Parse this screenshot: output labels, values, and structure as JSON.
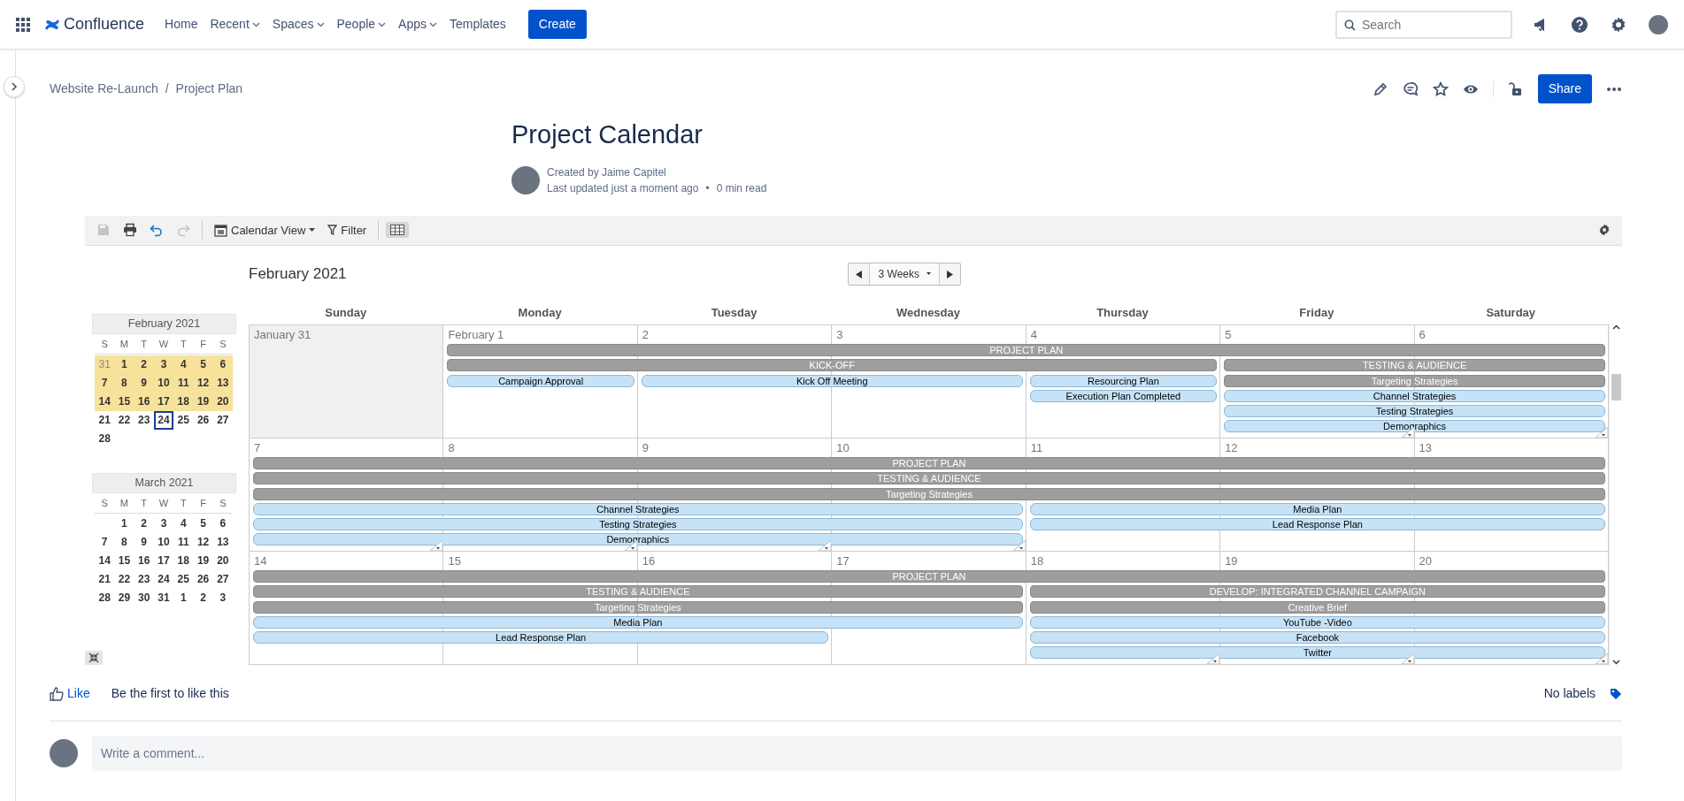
{
  "nav": {
    "brand": "Confluence",
    "items": [
      {
        "label": "Home",
        "dropdown": false
      },
      {
        "label": "Recent",
        "dropdown": true
      },
      {
        "label": "Spaces",
        "dropdown": true
      },
      {
        "label": "People",
        "dropdown": true
      },
      {
        "label": "Apps",
        "dropdown": true
      },
      {
        "label": "Templates",
        "dropdown": false
      }
    ],
    "create": "Create",
    "search": {
      "placeholder": "Search"
    }
  },
  "breadcrumbs": {
    "items": [
      "Website Re-Launch",
      "Project Plan"
    ],
    "separator": "/"
  },
  "share": "Share",
  "page": {
    "title": "Project Calendar",
    "author": "Created by Jaime Capitel",
    "updated": "Last updated just a moment ago",
    "separator": "•",
    "read_time": "0 min read"
  },
  "toolbar": {
    "items": [
      {
        "kind": "save",
        "disabled": true
      },
      {
        "kind": "print",
        "disabled": false
      },
      {
        "kind": "undo",
        "disabled": false
      },
      {
        "kind": "redo",
        "disabled": true
      }
    ],
    "view": "Calendar View",
    "filter": "Filter",
    "grid_toggle_selected": true
  },
  "mini_calendars": [
    {
      "title": "February 2021",
      "weekdays": [
        "S",
        "M",
        "T",
        "W",
        "T",
        "F",
        "S"
      ],
      "weeks": [
        [
          {
            "d": "31",
            "muted": true,
            "highlighted": true,
            "today": false
          },
          {
            "d": "1",
            "muted": false,
            "highlighted": true,
            "today": false
          },
          {
            "d": "2",
            "muted": false,
            "highlighted": true,
            "today": false
          },
          {
            "d": "3",
            "muted": false,
            "highlighted": true,
            "today": false
          },
          {
            "d": "4",
            "muted": false,
            "highlighted": true,
            "today": false
          },
          {
            "d": "5",
            "muted": false,
            "highlighted": true,
            "today": false
          },
          {
            "d": "6",
            "muted": false,
            "highlighted": true,
            "today": false
          }
        ],
        [
          {
            "d": "7",
            "muted": false,
            "highlighted": true,
            "today": false
          },
          {
            "d": "8",
            "muted": false,
            "highlighted": true,
            "today": false
          },
          {
            "d": "9",
            "muted": false,
            "highlighted": true,
            "today": false
          },
          {
            "d": "10",
            "muted": false,
            "highlighted": true,
            "today": false
          },
          {
            "d": "11",
            "muted": false,
            "highlighted": true,
            "today": false
          },
          {
            "d": "12",
            "muted": false,
            "highlighted": true,
            "today": false
          },
          {
            "d": "13",
            "muted": false,
            "highlighted": true,
            "today": false
          }
        ],
        [
          {
            "d": "14",
            "muted": false,
            "highlighted": true,
            "today": false
          },
          {
            "d": "15",
            "muted": false,
            "highlighted": true,
            "today": false
          },
          {
            "d": "16",
            "muted": false,
            "highlighted": true,
            "today": false
          },
          {
            "d": "17",
            "muted": false,
            "highlighted": true,
            "today": false
          },
          {
            "d": "18",
            "muted": false,
            "highlighted": true,
            "today": false
          },
          {
            "d": "19",
            "muted": false,
            "highlighted": true,
            "today": false
          },
          {
            "d": "20",
            "muted": false,
            "highlighted": true,
            "today": false
          }
        ],
        [
          {
            "d": "21",
            "muted": false,
            "highlighted": false,
            "today": false
          },
          {
            "d": "22",
            "muted": false,
            "highlighted": false,
            "today": false
          },
          {
            "d": "23",
            "muted": false,
            "highlighted": false,
            "today": false
          },
          {
            "d": "24",
            "muted": false,
            "highlighted": false,
            "today": true
          },
          {
            "d": "25",
            "muted": false,
            "highlighted": false,
            "today": false
          },
          {
            "d": "26",
            "muted": false,
            "highlighted": false,
            "today": false
          },
          {
            "d": "27",
            "muted": false,
            "highlighted": false,
            "today": false
          }
        ],
        [
          {
            "d": "28",
            "muted": false,
            "highlighted": false,
            "today": false
          }
        ]
      ]
    },
    {
      "title": "March 2021",
      "weekdays": [
        "S",
        "M",
        "T",
        "W",
        "T",
        "F",
        "S"
      ],
      "weeks": [
        [
          {
            "d": "1",
            "muted": false,
            "highlighted": false,
            "today": false
          },
          {
            "d": "2",
            "muted": false,
            "highlighted": false,
            "today": false
          },
          {
            "d": "3",
            "muted": false,
            "highlighted": false,
            "today": false
          },
          {
            "d": "4",
            "muted": false,
            "highlighted": false,
            "today": false
          },
          {
            "d": "5",
            "muted": false,
            "highlighted": false,
            "today": false
          },
          {
            "d": "6",
            "muted": false,
            "highlighted": false,
            "today": false
          }
        ],
        [
          {
            "d": "7",
            "muted": false,
            "highlighted": false,
            "today": false
          },
          {
            "d": "8",
            "muted": false,
            "highlighted": false,
            "today": false
          },
          {
            "d": "9",
            "muted": false,
            "highlighted": false,
            "today": false
          },
          {
            "d": "10",
            "muted": false,
            "highlighted": false,
            "today": false
          },
          {
            "d": "11",
            "muted": false,
            "highlighted": false,
            "today": false
          },
          {
            "d": "12",
            "muted": false,
            "highlighted": false,
            "today": false
          },
          {
            "d": "13",
            "muted": false,
            "highlighted": false,
            "today": false
          }
        ],
        [
          {
            "d": "14",
            "muted": false,
            "highlighted": false,
            "today": false
          },
          {
            "d": "15",
            "muted": false,
            "highlighted": false,
            "today": false
          },
          {
            "d": "16",
            "muted": false,
            "highlighted": false,
            "today": false
          },
          {
            "d": "17",
            "muted": false,
            "highlighted": false,
            "today": false
          },
          {
            "d": "18",
            "muted": false,
            "highlighted": false,
            "today": false
          },
          {
            "d": "19",
            "muted": false,
            "highlighted": false,
            "today": false
          },
          {
            "d": "20",
            "muted": false,
            "highlighted": false,
            "today": false
          }
        ],
        [
          {
            "d": "21",
            "muted": false,
            "highlighted": false,
            "today": false
          },
          {
            "d": "22",
            "muted": false,
            "highlighted": false,
            "today": false
          },
          {
            "d": "23",
            "muted": false,
            "highlighted": false,
            "today": false
          },
          {
            "d": "24",
            "muted": false,
            "highlighted": false,
            "today": false
          },
          {
            "d": "25",
            "muted": false,
            "highlighted": false,
            "today": false
          },
          {
            "d": "26",
            "muted": false,
            "highlighted": false,
            "today": false
          },
          {
            "d": "27",
            "muted": false,
            "highlighted": false,
            "today": false
          }
        ],
        [
          {
            "d": "28",
            "muted": false,
            "highlighted": false,
            "today": false
          },
          {
            "d": "29",
            "muted": false,
            "highlighted": false,
            "today": false
          },
          {
            "d": "30",
            "muted": false,
            "highlighted": false,
            "today": false
          },
          {
            "d": "31",
            "muted": false,
            "highlighted": false,
            "today": false
          },
          {
            "d": "1",
            "muted": false,
            "highlighted": false,
            "today": false
          },
          {
            "d": "2",
            "muted": false,
            "highlighted": false,
            "today": false
          },
          {
            "d": "3",
            "muted": false,
            "highlighted": false,
            "today": false
          }
        ]
      ]
    }
  ],
  "calendar": {
    "title": "February 2021",
    "range": "3 Weeks",
    "weekdays": [
      "Sunday",
      "Monday",
      "Tuesday",
      "Wednesday",
      "Thursday",
      "Friday",
      "Saturday"
    ],
    "weeks": [
      {
        "days": [
          {
            "label": "January 31",
            "outside": true,
            "more": false
          },
          {
            "label": "February 1",
            "outside": false,
            "more": false
          },
          {
            "label": "2",
            "outside": false,
            "more": false
          },
          {
            "label": "3",
            "outside": false,
            "more": false
          },
          {
            "label": "4",
            "outside": false,
            "more": false
          },
          {
            "label": "5",
            "outside": false,
            "more": true
          },
          {
            "label": "6",
            "outside": false,
            "more": true
          }
        ],
        "lanes": [
          [
            {
              "kind": "empty"
            },
            {
              "kind": "group",
              "label": "PROJECT PLAN"
            },
            {
              "kind": "continued"
            },
            {
              "kind": "continued"
            },
            {
              "kind": "continued"
            },
            {
              "kind": "continued"
            },
            {
              "kind": "continued"
            }
          ],
          [
            {
              "kind": "empty"
            },
            {
              "kind": "group",
              "label": "KICK-OFF"
            },
            {
              "kind": "continued"
            },
            {
              "kind": "continued"
            },
            {
              "kind": "continued"
            },
            {
              "kind": "group",
              "label": "TESTING & AUDIENCE"
            },
            {
              "kind": "continued"
            }
          ],
          [
            {
              "kind": "empty"
            },
            {
              "kind": "task",
              "label": "Campaign Approval"
            },
            {
              "kind": "task",
              "label": "Kick Off Meeting"
            },
            {
              "kind": "continued"
            },
            {
              "kind": "task",
              "label": "Resourcing Plan"
            },
            {
              "kind": "group",
              "label": "Targeting Strategies"
            },
            {
              "kind": "continued"
            }
          ],
          [
            {
              "kind": "empty"
            },
            {
              "kind": "empty"
            },
            {
              "kind": "empty"
            },
            {
              "kind": "empty"
            },
            {
              "kind": "task",
              "label": "Execution Plan Completed"
            },
            {
              "kind": "task",
              "label": "Channel Strategies"
            },
            {
              "kind": "continued"
            }
          ],
          [
            {
              "kind": "empty"
            },
            {
              "kind": "empty"
            },
            {
              "kind": "empty"
            },
            {
              "kind": "empty"
            },
            {
              "kind": "empty"
            },
            {
              "kind": "task",
              "label": "Testing Strategies"
            },
            {
              "kind": "continued"
            }
          ],
          [
            {
              "kind": "empty"
            },
            {
              "kind": "empty"
            },
            {
              "kind": "empty"
            },
            {
              "kind": "empty"
            },
            {
              "kind": "empty"
            },
            {
              "kind": "task",
              "label": "Demographics"
            },
            {
              "kind": "continued"
            }
          ]
        ]
      },
      {
        "days": [
          {
            "label": "7",
            "outside": false,
            "more": true
          },
          {
            "label": "8",
            "outside": false,
            "more": true
          },
          {
            "label": "9",
            "outside": false,
            "more": true
          },
          {
            "label": "10",
            "outside": false,
            "more": true
          },
          {
            "label": "11",
            "outside": false,
            "more": false
          },
          {
            "label": "12",
            "outside": false,
            "more": false
          },
          {
            "label": "13",
            "outside": false,
            "more": false
          }
        ],
        "lanes": [
          [
            {
              "kind": "group",
              "label": "PROJECT PLAN"
            },
            {
              "kind": "continued"
            },
            {
              "kind": "continued"
            },
            {
              "kind": "continued"
            },
            {
              "kind": "continued"
            },
            {
              "kind": "continued"
            },
            {
              "kind": "continued"
            }
          ],
          [
            {
              "kind": "group",
              "label": "TESTING & AUDIENCE"
            },
            {
              "kind": "continued"
            },
            {
              "kind": "continued"
            },
            {
              "kind": "continued"
            },
            {
              "kind": "continued"
            },
            {
              "kind": "continued"
            },
            {
              "kind": "continued"
            }
          ],
          [
            {
              "kind": "group",
              "label": "Targeting Strategies"
            },
            {
              "kind": "continued"
            },
            {
              "kind": "continued"
            },
            {
              "kind": "continued"
            },
            {
              "kind": "continued"
            },
            {
              "kind": "continued"
            },
            {
              "kind": "continued"
            }
          ],
          [
            {
              "kind": "task",
              "label": "Channel Strategies"
            },
            {
              "kind": "continued"
            },
            {
              "kind": "continued"
            },
            {
              "kind": "continued"
            },
            {
              "kind": "task",
              "label": "Media Plan"
            },
            {
              "kind": "continued"
            },
            {
              "kind": "continued"
            }
          ],
          [
            {
              "kind": "task",
              "label": "Testing Strategies"
            },
            {
              "kind": "continued"
            },
            {
              "kind": "continued"
            },
            {
              "kind": "continued"
            },
            {
              "kind": "task",
              "label": "Lead Response Plan"
            },
            {
              "kind": "continued"
            },
            {
              "kind": "continued"
            }
          ],
          [
            {
              "kind": "task",
              "label": "Demographics"
            },
            {
              "kind": "continued"
            },
            {
              "kind": "continued"
            },
            {
              "kind": "continued"
            },
            {
              "kind": "empty"
            },
            {
              "kind": "empty"
            },
            {
              "kind": "empty"
            }
          ]
        ]
      },
      {
        "days": [
          {
            "label": "14",
            "outside": false,
            "more": false
          },
          {
            "label": "15",
            "outside": false,
            "more": false
          },
          {
            "label": "16",
            "outside": false,
            "more": false
          },
          {
            "label": "17",
            "outside": false,
            "more": false
          },
          {
            "label": "18",
            "outside": false,
            "more": true
          },
          {
            "label": "19",
            "outside": false,
            "more": true
          },
          {
            "label": "20",
            "outside": false,
            "more": true
          }
        ],
        "lanes": [
          [
            {
              "kind": "group",
              "label": "PROJECT PLAN"
            },
            {
              "kind": "continued"
            },
            {
              "kind": "continued"
            },
            {
              "kind": "continued"
            },
            {
              "kind": "continued"
            },
            {
              "kind": "continued"
            },
            {
              "kind": "continued"
            }
          ],
          [
            {
              "kind": "group",
              "label": "TESTING & AUDIENCE"
            },
            {
              "kind": "continued"
            },
            {
              "kind": "continued"
            },
            {
              "kind": "continued"
            },
            {
              "kind": "group",
              "label": "DEVELOP: INTEGRATED CHANNEL CAMPAIGN"
            },
            {
              "kind": "continued"
            },
            {
              "kind": "continued"
            }
          ],
          [
            {
              "kind": "group",
              "label": "Targeting Strategies"
            },
            {
              "kind": "continued"
            },
            {
              "kind": "continued"
            },
            {
              "kind": "continued"
            },
            {
              "kind": "group",
              "label": "Creative Brief"
            },
            {
              "kind": "continued"
            },
            {
              "kind": "continued"
            }
          ],
          [
            {
              "kind": "task",
              "label": "Media Plan"
            },
            {
              "kind": "continued"
            },
            {
              "kind": "continued"
            },
            {
              "kind": "continued"
            },
            {
              "kind": "task",
              "label": "YouTube -Video"
            },
            {
              "kind": "continued"
            },
            {
              "kind": "continued"
            }
          ],
          [
            {
              "kind": "task",
              "label": "Lead Response Plan"
            },
            {
              "kind": "continued"
            },
            {
              "kind": "continued"
            },
            {
              "kind": "empty"
            },
            {
              "kind": "task",
              "label": "Facebook"
            },
            {
              "kind": "continued"
            },
            {
              "kind": "continued"
            }
          ],
          [
            {
              "kind": "empty"
            },
            {
              "kind": "empty"
            },
            {
              "kind": "empty"
            },
            {
              "kind": "empty"
            },
            {
              "kind": "task",
              "label": "Twitter"
            },
            {
              "kind": "continued"
            },
            {
              "kind": "continued"
            }
          ]
        ]
      }
    ]
  },
  "footer": {
    "like": "Like",
    "like_note": "Be the first to like this",
    "labels": "No labels",
    "comment": {
      "placeholder": "Write a comment..."
    }
  }
}
